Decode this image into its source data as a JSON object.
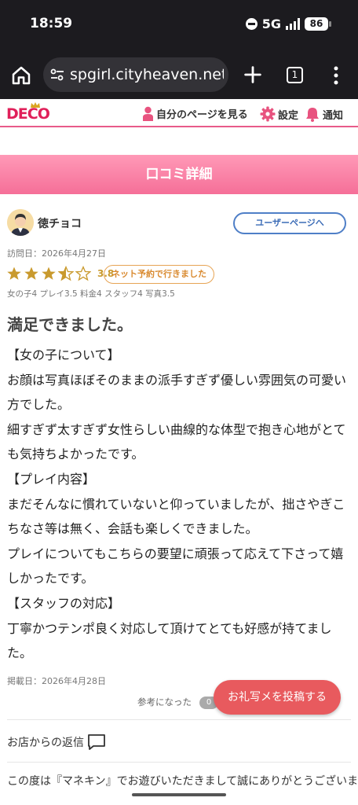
{
  "status_bar": {
    "time": "18:59",
    "network": "5G",
    "battery": "86"
  },
  "browser": {
    "url": "spgirl.cityheaven.net/",
    "tab_count": "1"
  },
  "site_header": {
    "logo": "DECO",
    "my_page": "自分のページを見る",
    "settings": "設定",
    "notifications": "通知"
  },
  "page_title": "口コミ詳細",
  "reviewer": {
    "name": "徳チョコ",
    "user_page_button": "ユーザーページへ",
    "visit_date": "訪問日：2026年4月27日"
  },
  "rating": {
    "value": "3.8",
    "stars": 3.5,
    "badge": "ネット予約で行きました",
    "sub_scores": "女の子4 プレイ3.5 料金4 スタッフ4 写真3.5",
    "accent_color": "#c99a2e"
  },
  "review": {
    "title": "満足できました。",
    "body": "【女の子について】\nお顔は写真ほぼそのままの派手すぎず優しい雰囲気の可愛い方でした。\n細すぎず太すぎず女性らしい曲線的な体型で抱き心地がとても気持ちよかったです。\n【プレイ内容】\nまだそんなに慣れていないと仰っていましたが、拙さやぎこちなさ等は無く、会話も楽しくできました。\nプレイについてもこちらの要望に頑張って応えて下さって嬉しかったです。\n【スタッフの対応】\n丁寧かつテンポ良く対応して頂けてとても好感が持てました。",
    "post_date": "掲載日：2026年4月28日"
  },
  "helpful": {
    "label": "参考になった",
    "count": "0"
  },
  "photo_button": "お礼写メを投稿する",
  "shop_reply": {
    "heading": "お店からの返信",
    "text": "この度は『マネキン』でお遊びいただきまして誠にありがとうございます"
  }
}
